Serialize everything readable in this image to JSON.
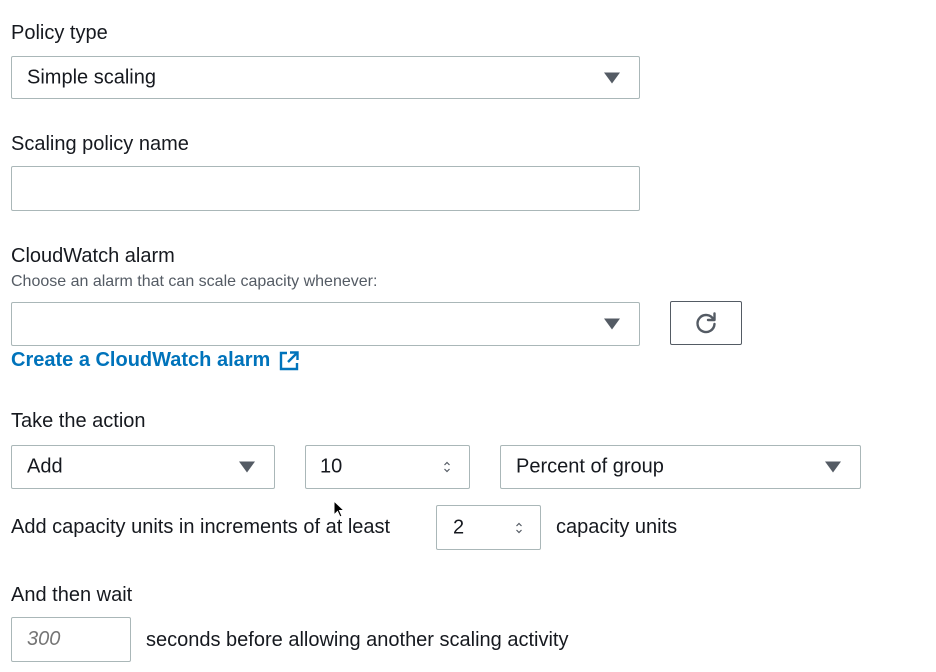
{
  "policy_type": {
    "label": "Policy type",
    "selected": "Simple scaling",
    "icon": "caret-down-icon"
  },
  "policy_name": {
    "label": "Scaling policy name",
    "value": ""
  },
  "alarm": {
    "label": "CloudWatch alarm",
    "description": "Choose an alarm that can scale capacity whenever:",
    "selected": "",
    "refresh_icon": "refresh-icon",
    "create_link": "Create a CloudWatch alarm",
    "external_icon": "external-link-icon"
  },
  "action": {
    "label": "Take the action",
    "operation": "Add",
    "amount": "10",
    "unit": "Percent of group",
    "increment_prefix": "Add capacity units in increments of at least",
    "increment_value": "2",
    "increment_suffix": "capacity units"
  },
  "wait": {
    "label": "And then wait",
    "placeholder": "300",
    "suffix": "seconds before allowing another scaling activity"
  },
  "colors": {
    "link": "#0073bb",
    "border": "#aab7b8",
    "text": "#16191f",
    "muted": "#545b64"
  }
}
